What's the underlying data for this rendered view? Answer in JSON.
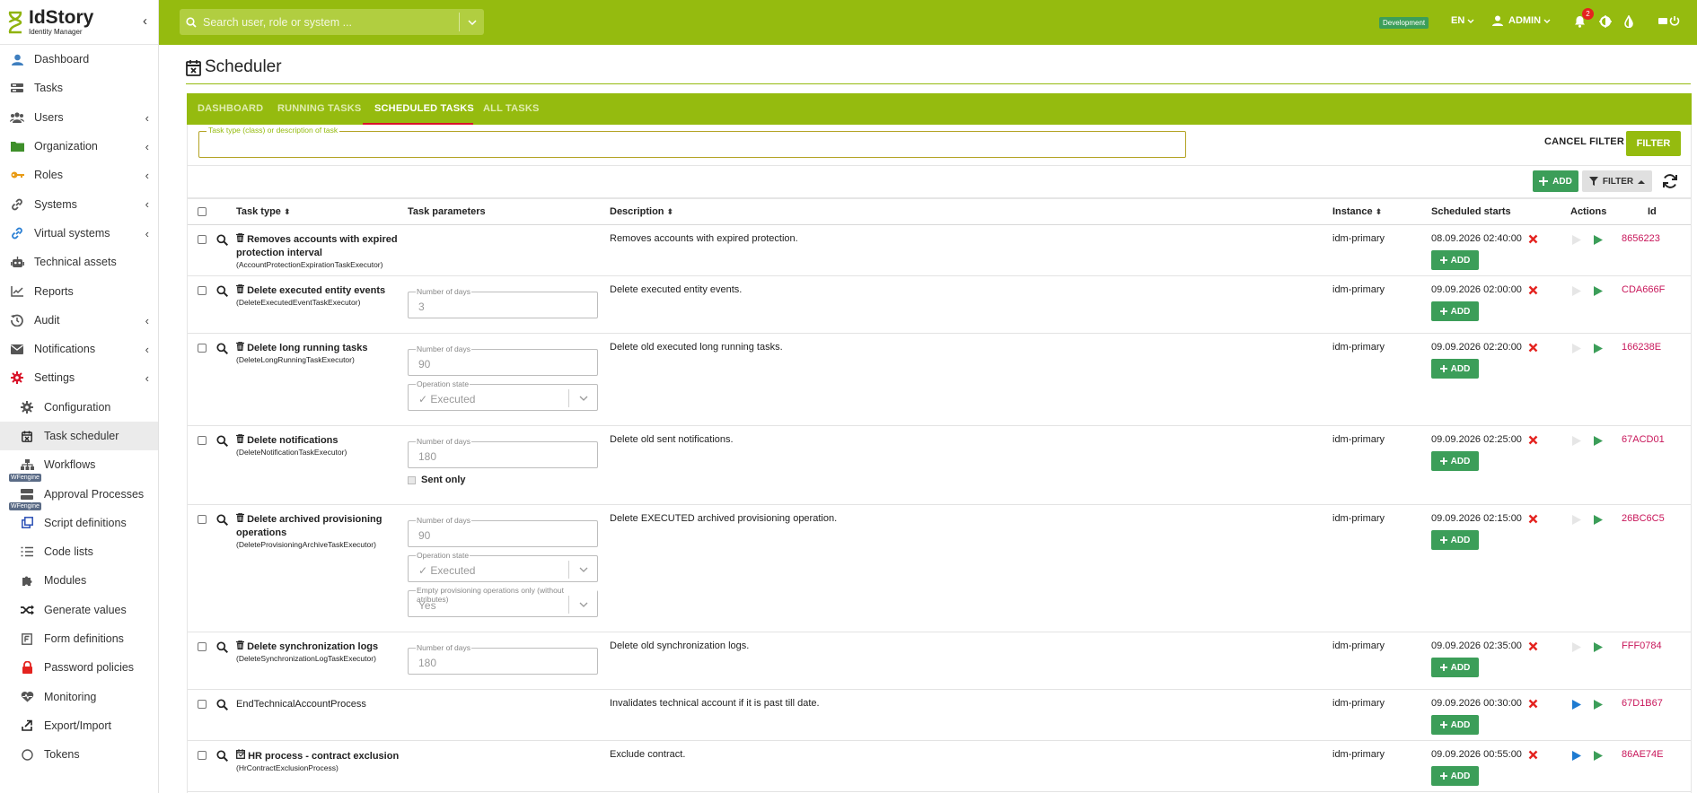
{
  "app": {
    "name": "IdStory",
    "subtitle": "Identity Manager"
  },
  "sidebar": {
    "items": [
      {
        "label": "Dashboard",
        "icon": "user-icon",
        "chevron": false
      },
      {
        "label": "Tasks",
        "icon": "tasks-icon",
        "chevron": false
      },
      {
        "label": "Users",
        "icon": "users-icon",
        "chevron": true
      },
      {
        "label": "Organization",
        "icon": "folder-icon",
        "chevron": true
      },
      {
        "label": "Roles",
        "icon": "key-icon",
        "chevron": true
      },
      {
        "label": "Systems",
        "icon": "link-icon",
        "chevron": true
      },
      {
        "label": "Virtual systems",
        "icon": "link-icon",
        "chevron": true
      },
      {
        "label": "Technical assets",
        "icon": "robot-icon",
        "chevron": false
      },
      {
        "label": "Reports",
        "icon": "chart-icon",
        "chevron": false
      },
      {
        "label": "Audit",
        "icon": "history-icon",
        "chevron": true
      },
      {
        "label": "Notifications",
        "icon": "envelope-icon",
        "chevron": true
      },
      {
        "label": "Settings",
        "icon": "gear-icon",
        "chevron": true
      },
      {
        "label": "Configuration",
        "icon": "gear-icon",
        "chevron": false,
        "sub": true
      },
      {
        "label": "Task scheduler",
        "icon": "calendar-icon",
        "chevron": false,
        "sub": true,
        "active": true
      },
      {
        "label": "Workflows",
        "icon": "sitemap-icon",
        "chevron": false,
        "sub": true,
        "badge": "WFengine"
      },
      {
        "label": "Approval Processes",
        "icon": "server-icon",
        "chevron": false,
        "sub": true,
        "badge": "WFengine"
      },
      {
        "label": "Script definitions",
        "icon": "clone-icon",
        "chevron": false,
        "sub": true
      },
      {
        "label": "Code lists",
        "icon": "list-icon",
        "chevron": false,
        "sub": true
      },
      {
        "label": "Modules",
        "icon": "puzzle-icon",
        "chevron": false,
        "sub": true
      },
      {
        "label": "Generate values",
        "icon": "random-icon",
        "chevron": false,
        "sub": true
      },
      {
        "label": "Form definitions",
        "icon": "form-icon",
        "chevron": false,
        "sub": true
      },
      {
        "label": "Password policies",
        "icon": "lock-icon",
        "chevron": false,
        "sub": true
      },
      {
        "label": "Monitoring",
        "icon": "heartbeat-icon",
        "chevron": false,
        "sub": true
      },
      {
        "label": "Export/Import",
        "icon": "export-icon",
        "chevron": false,
        "sub": true
      },
      {
        "label": "Tokens",
        "icon": "circle-icon",
        "chevron": false,
        "sub": true
      }
    ]
  },
  "topbar": {
    "search_placeholder": "Search user, role or system ...",
    "env": "Development",
    "lang": "EN",
    "user": "ADMIN",
    "notifications": "2"
  },
  "page": {
    "title": "Scheduler"
  },
  "tabs": [
    "DASHBOARD",
    "RUNNING TASKS",
    "SCHEDULED TASKS",
    "ALL TASKS"
  ],
  "filter": {
    "label": "Task type (class) or description of task",
    "cancel": "CANCEL FILTER",
    "apply": "FILTER"
  },
  "toolbar": {
    "add": "ADD",
    "filter": "FILTER"
  },
  "table": {
    "headers": {
      "task_type": "Task type",
      "task_params": "Task parameters",
      "description": "Description",
      "instance": "Instance",
      "scheduled": "Scheduled starts",
      "actions": "Actions",
      "id": "Id"
    },
    "add_label": "ADD",
    "rows": [
      {
        "title": "Removes accounts with expired protection interval",
        "class": "(AccountProtectionExpirationTaskExecutor)",
        "description": "Removes accounts with expired protection.",
        "instance": "idm-primary",
        "scheduled": "08.09.2026 02:40:00",
        "id": "8656223",
        "trash": true,
        "params": []
      },
      {
        "title": "Delete executed entity events",
        "class": "(DeleteExecutedEventTaskExecutor)",
        "description": "Delete executed entity events.",
        "instance": "idm-primary",
        "scheduled": "09.09.2026 02:00:00",
        "id": "CDA666F",
        "trash": true,
        "params": [
          {
            "label": "Number of days",
            "value": "3"
          }
        ]
      },
      {
        "title": "Delete long running tasks",
        "class": "(DeleteLongRunningTaskExecutor)",
        "description": "Delete old executed long running tasks.",
        "instance": "idm-primary",
        "scheduled": "09.09.2026 02:20:00",
        "id": "166238E",
        "trash": true,
        "params": [
          {
            "label": "Number of days",
            "value": "90"
          },
          {
            "label": "Operation state",
            "value": "✓ Executed",
            "select": true
          }
        ]
      },
      {
        "title": "Delete notifications",
        "class": "(DeleteNotificationTaskExecutor)",
        "description": "Delete old sent notifications.",
        "instance": "idm-primary",
        "scheduled": "09.09.2026 02:25:00",
        "id": "67ACD01",
        "trash": true,
        "params": [
          {
            "label": "Number of days",
            "value": "180"
          }
        ],
        "check": "Sent only"
      },
      {
        "title": "Delete archived provisioning operations",
        "class": "(DeleteProvisioningArchiveTaskExecutor)",
        "description": "Delete EXECUTED archived provisioning operation.",
        "instance": "idm-primary",
        "scheduled": "09.09.2026 02:15:00",
        "id": "26BC6C5",
        "trash": true,
        "params": [
          {
            "label": "Number of days",
            "value": "90"
          },
          {
            "label": "Operation state",
            "value": "✓ Executed",
            "select": true
          },
          {
            "label": "Empty provisioning operations only (without atributes)",
            "value": "Yes",
            "select": true
          }
        ]
      },
      {
        "title": "Delete synchronization logs",
        "class": "(DeleteSynchronizationLogTaskExecutor)",
        "description": "Delete old synchronization logs.",
        "instance": "idm-primary",
        "scheduled": "09.09.2026 02:35:00",
        "id": "FFF0784",
        "trash": true,
        "params": [
          {
            "label": "Number of days",
            "value": "180"
          }
        ]
      },
      {
        "title": "EndTechnicalAccountProcess",
        "class": "",
        "description": "Invalidates technical account if it is past till date.",
        "instance": "idm-primary",
        "scheduled": "09.09.2026 00:30:00",
        "id": "67D1B67",
        "trash": false,
        "plain": true,
        "blue": true,
        "params": []
      },
      {
        "title": "HR process - contract exclusion",
        "class": "(HrContractExclusionProcess)",
        "description": "Exclude contract.",
        "instance": "idm-primary",
        "scheduled": "09.09.2026 00:55:00",
        "id": "86AE74E",
        "trash": false,
        "cal": true,
        "blue": true,
        "params": []
      }
    ]
  }
}
